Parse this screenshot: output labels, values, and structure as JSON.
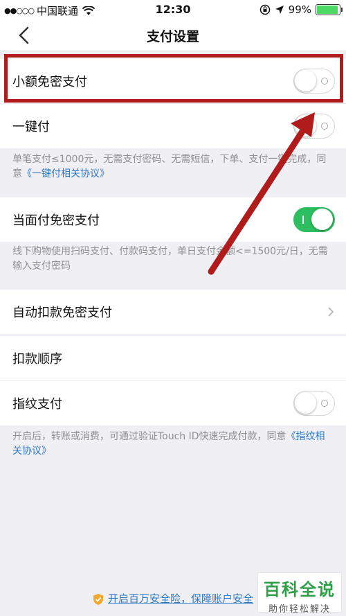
{
  "status_bar": {
    "signal_dots": "●●○○○",
    "carrier": "中国联通",
    "time": "12:30",
    "battery": "99%",
    "battery_level": 0.99
  },
  "nav": {
    "title": "支付设置",
    "back_icon": "chevron-left-icon"
  },
  "settings": {
    "small_amount": {
      "label": "小额免密支付",
      "enabled": false
    },
    "one_click": {
      "label": "一键付",
      "enabled": false,
      "desc": "单笔支付≤1000元，无需支付密码、无需短信，下单、支付一键完成，同意",
      "link": "《一键付相关协议》"
    },
    "face_to_face": {
      "label": "当面付免密支付",
      "enabled": true,
      "desc": "线下购物使用扫码支付、付款码支付，单日支付金额<=1500元/日，无需输入支付密码"
    },
    "auto_deduct": {
      "label": "自动扣款免密支付"
    },
    "deduct_order": {
      "label": "扣款顺序"
    },
    "fingerprint": {
      "label": "指纹支付",
      "enabled": false,
      "desc": "开启后，转账或消费，可通过验证Touch ID快速完成付款，同意",
      "link": "《指纹相关协议》"
    }
  },
  "footer": {
    "link": "开启百万安全险，保障账户安全"
  },
  "watermark": {
    "title": "百科全说",
    "subtitle": "助你轻松解决"
  },
  "colors": {
    "accent_green": "#2dbe60",
    "link_blue": "#2f78c2",
    "annotation_red": "#b01c1c"
  }
}
